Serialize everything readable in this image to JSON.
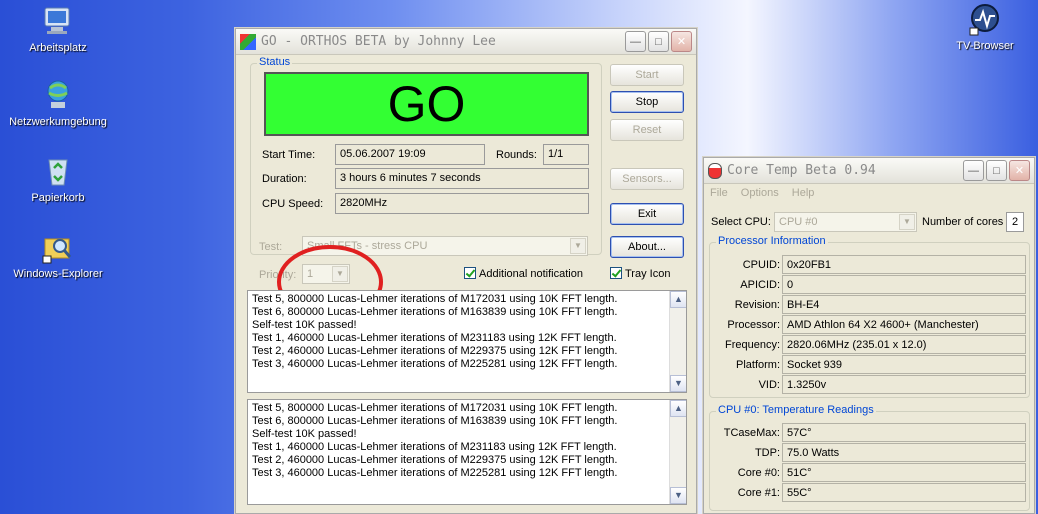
{
  "desktop": {
    "icons": [
      {
        "label": "Arbeitsplatz",
        "icon": "my-computer-icon"
      },
      {
        "label": "Netzwerkumgebung",
        "icon": "network-icon"
      },
      {
        "label": "Papierkorb",
        "icon": "recycle-bin-icon"
      },
      {
        "label": "Windows-Explorer",
        "icon": "explorer-icon"
      },
      {
        "label": "TV-Browser",
        "icon": "tv-browser-icon"
      }
    ]
  },
  "orthos": {
    "title": "GO - ORTHOS BETA by Johnny Lee",
    "status_group": "Status",
    "status_text": "GO",
    "status_color": "#33ff33",
    "start_time_label": "Start Time:",
    "start_time": "05.06.2007 19:09",
    "rounds_label": "Rounds:",
    "rounds": "1/1",
    "duration_label": "Duration:",
    "duration": "3 hours 6 minutes 7 seconds",
    "cpu_speed_label": "CPU Speed:",
    "cpu_speed": "2820MHz",
    "buttons": {
      "start": "Start",
      "stop": "Stop",
      "reset": "Reset",
      "sensors": "Sensors...",
      "exit": "Exit",
      "about": "About..."
    },
    "test_label": "Test:",
    "test_value": "Small FFTs - stress CPU",
    "priority_label": "Priority:",
    "priority_value": "1",
    "additional_notification": "Additional notification",
    "tray_icon": "Tray Icon",
    "log1": [
      "Test 5, 800000 Lucas-Lehmer iterations of M172031 using 10K FFT length.",
      "Test 6, 800000 Lucas-Lehmer iterations of M163839 using 10K FFT length.",
      "Self-test 10K passed!",
      "Test 1, 460000 Lucas-Lehmer iterations of M231183 using 12K FFT length.",
      "Test 2, 460000 Lucas-Lehmer iterations of M229375 using 12K FFT length.",
      "Test 3, 460000 Lucas-Lehmer iterations of M225281 using 12K FFT length."
    ],
    "log2": [
      "Test 5, 800000 Lucas-Lehmer iterations of M172031 using 10K FFT length.",
      "Test 6, 800000 Lucas-Lehmer iterations of M163839 using 10K FFT length.",
      "Self-test 10K passed!",
      "Test 1, 460000 Lucas-Lehmer iterations of M231183 using 12K FFT length.",
      "Test 2, 460000 Lucas-Lehmer iterations of M229375 using 12K FFT length.",
      "Test 3, 460000 Lucas-Lehmer iterations of M225281 using 12K FFT length."
    ]
  },
  "coretemp": {
    "title": "Core Temp Beta 0.94",
    "menu": [
      "File",
      "Options",
      "Help"
    ],
    "select_cpu_label": "Select CPU:",
    "select_cpu_value": "CPU #0",
    "num_cores_label": "Number of cores",
    "num_cores": "2",
    "processor_group": "Processor Information",
    "processor": [
      {
        "label": "CPUID:",
        "value": "0x20FB1"
      },
      {
        "label": "APICID:",
        "value": "0"
      },
      {
        "label": "Revision:",
        "value": "BH-E4"
      },
      {
        "label": "Processor:",
        "value": "AMD Athlon 64 X2 4600+ (Manchester)"
      },
      {
        "label": "Frequency:",
        "value": "2820.06MHz (235.01 x 12.0)"
      },
      {
        "label": "Platform:",
        "value": "Socket 939"
      },
      {
        "label": "VID:",
        "value": "1.3250v"
      }
    ],
    "temp_group": "CPU #0: Temperature Readings",
    "temps": [
      {
        "label": "TCaseMax:",
        "value": "57C°"
      },
      {
        "label": "TDP:",
        "value": "75.0 Watts"
      },
      {
        "label": "Core #0:",
        "value": "51C°"
      },
      {
        "label": "Core #1:",
        "value": "55C°"
      }
    ]
  },
  "colors": {
    "annotation_circle": "#e02020",
    "group_label": "#0046d5"
  }
}
